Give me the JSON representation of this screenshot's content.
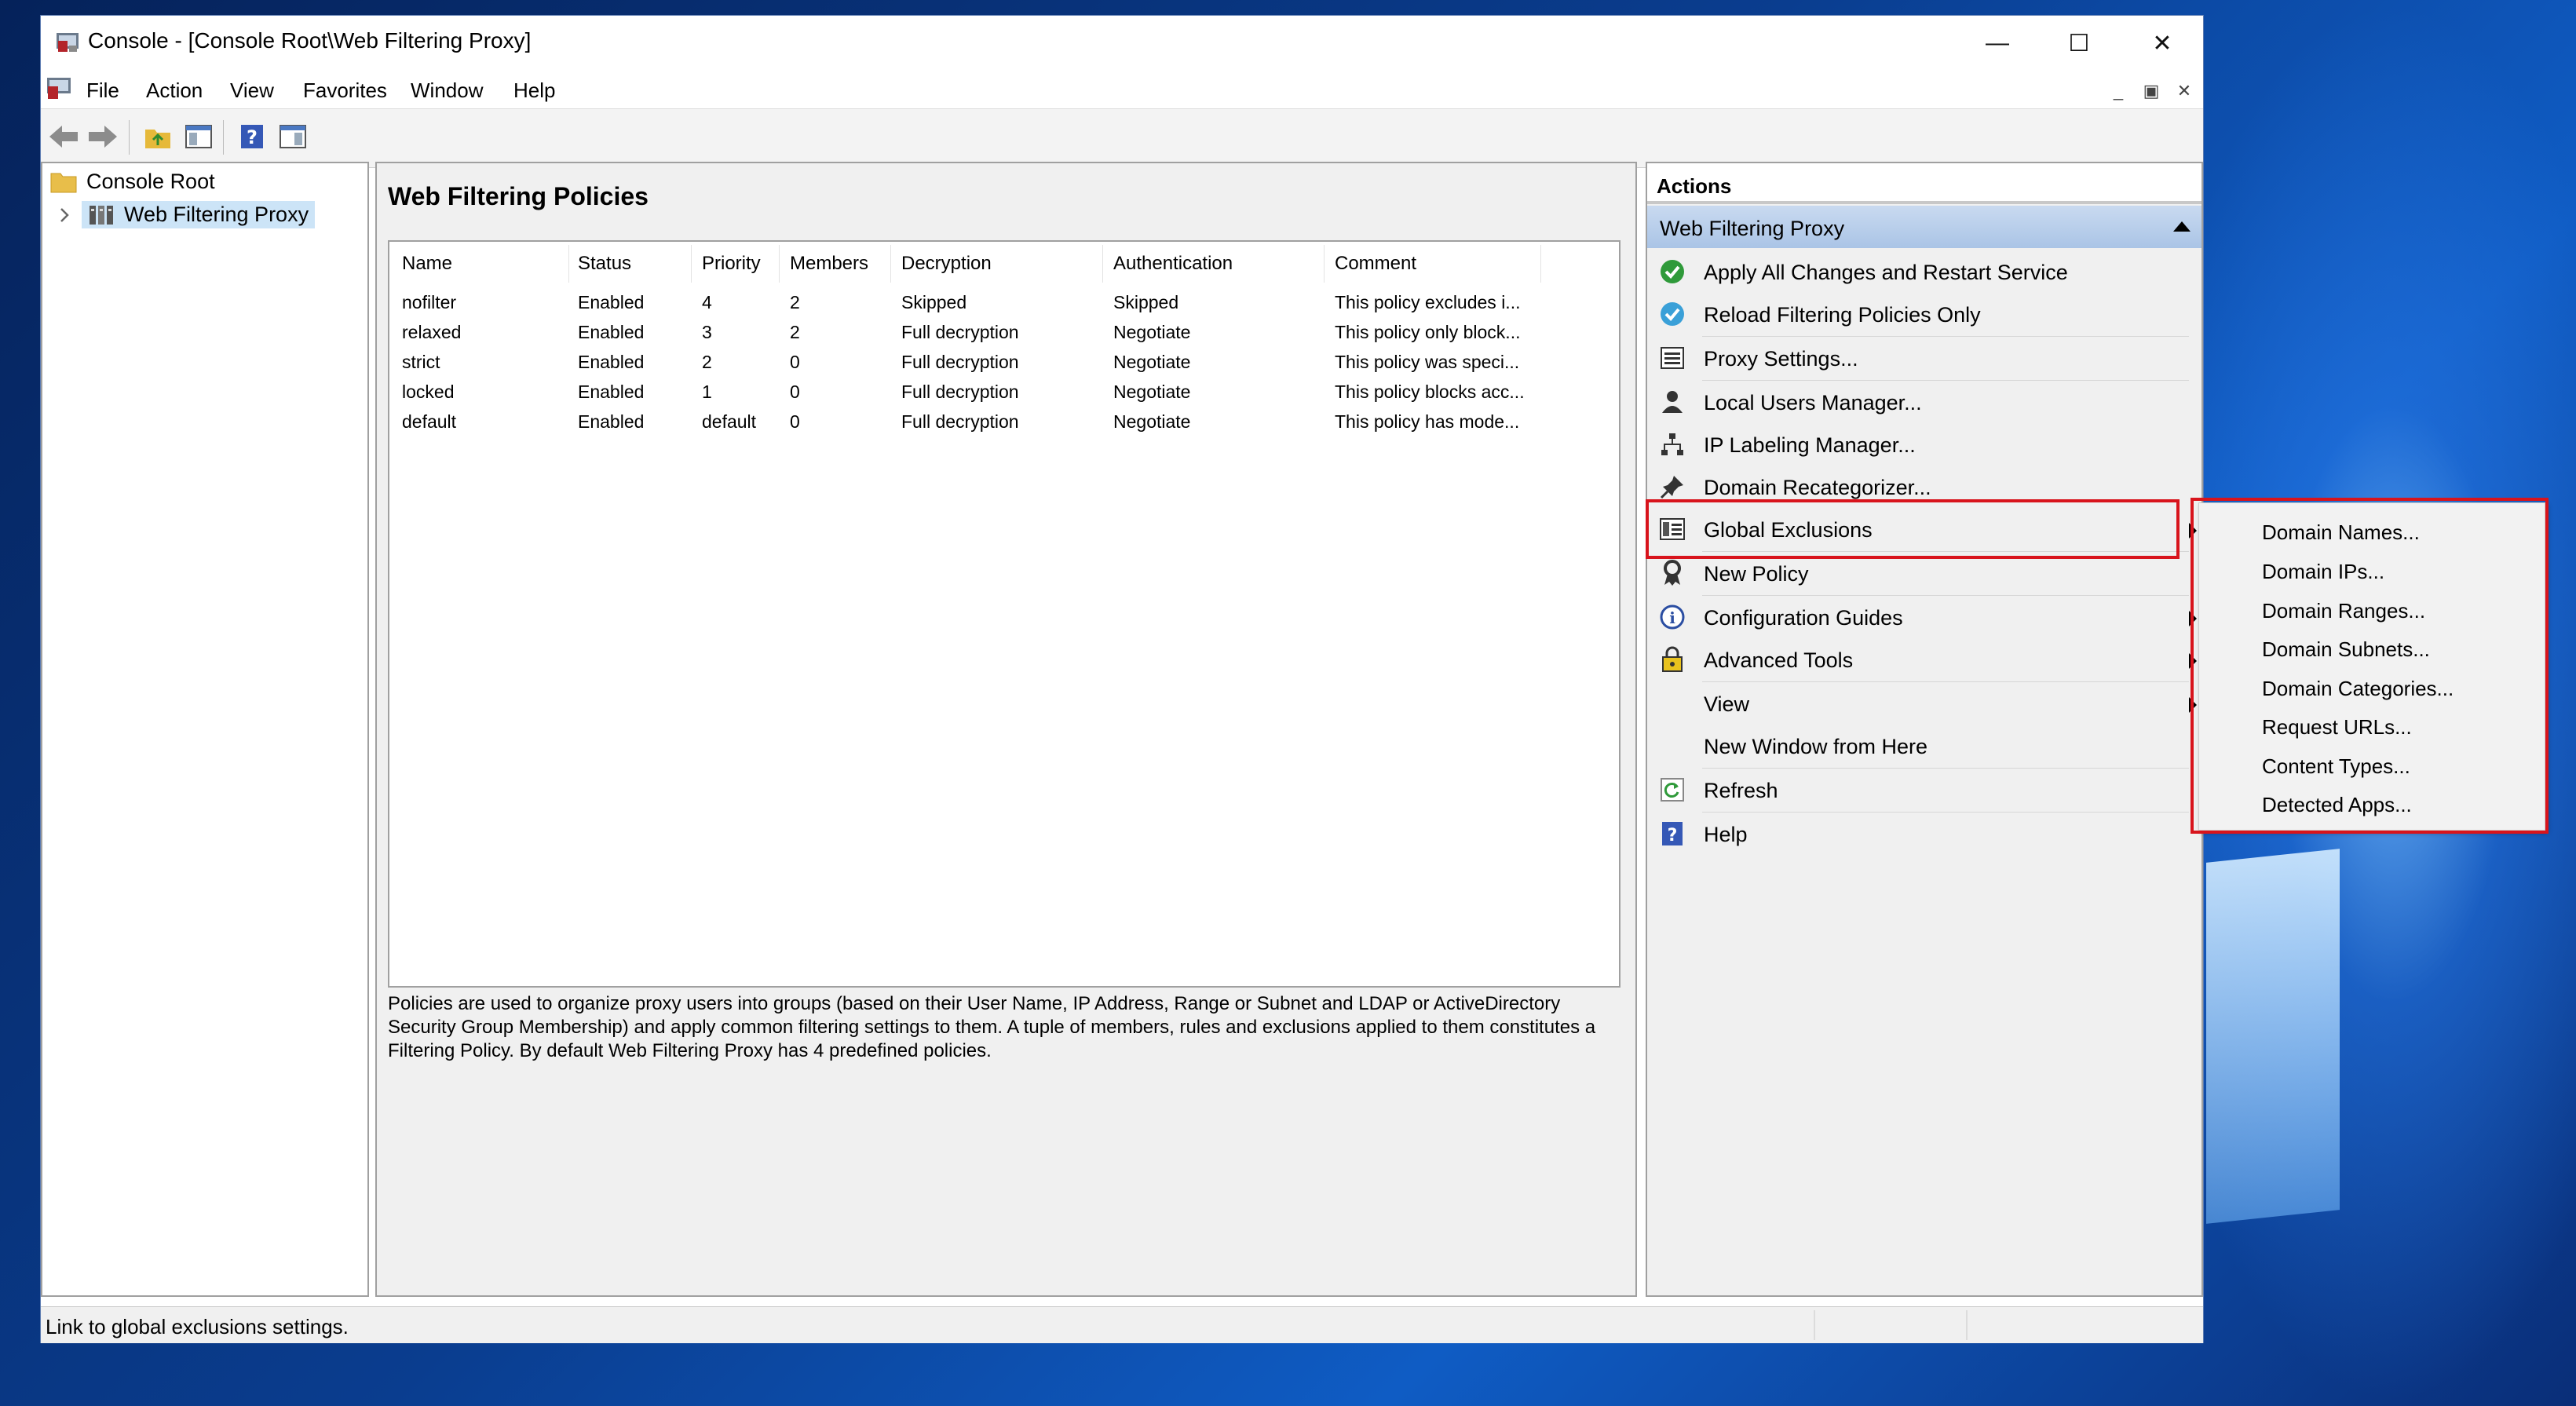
{
  "window": {
    "title": "Console - [Console Root\\Web Filtering Proxy]",
    "minimize_symbol": "—",
    "maximize_symbol": "☐",
    "close_symbol": "✕",
    "mdi_minimize_symbol": "_",
    "mdi_restore_symbol": "▣",
    "mdi_close_symbol": "✕"
  },
  "menu": [
    "File",
    "Action",
    "View",
    "Favorites",
    "Window",
    "Help"
  ],
  "tree": {
    "root": "Console Root",
    "child": "Web Filtering Proxy"
  },
  "center": {
    "title": "Web Filtering Policies",
    "columns": [
      "Name",
      "Status",
      "Priority",
      "Members",
      "Decryption",
      "Authentication",
      "Comment"
    ],
    "rows": [
      [
        "nofilter",
        "Enabled",
        "4",
        "2",
        "Skipped",
        "Skipped",
        "This policy excludes i..."
      ],
      [
        "relaxed",
        "Enabled",
        "3",
        "2",
        "Full decryption",
        "Negotiate",
        "This policy only block..."
      ],
      [
        "strict",
        "Enabled",
        "2",
        "0",
        "Full decryption",
        "Negotiate",
        "This policy was speci..."
      ],
      [
        "locked",
        "Enabled",
        "1",
        "0",
        "Full decryption",
        "Negotiate",
        "This policy blocks acc..."
      ],
      [
        "default",
        "Enabled",
        "default",
        "0",
        "Full decryption",
        "Negotiate",
        "This policy has mode..."
      ]
    ],
    "description_lines": [
      "Policies are used to organize proxy users into groups (based on their User Name, IP Address, Range or Subnet and LDAP or ActiveDirectory",
      "Security Group Membership) and apply common filtering settings to them. A tuple of members, rules and exclusions applied to them constitutes a",
      "Filtering Policy. By default Web Filtering Proxy has 4 predefined policies."
    ]
  },
  "actions": {
    "header": "Actions",
    "group": "Web Filtering Proxy",
    "items": [
      {
        "label": "Apply All Changes and Restart Service",
        "icon": "check-circle-icon"
      },
      {
        "label": "Reload Filtering Policies Only",
        "icon": "check-circle-blue-icon"
      },
      {
        "label": "Proxy Settings...",
        "icon": "settings-list-icon"
      },
      {
        "label": "Local Users Manager...",
        "icon": "user-icon"
      },
      {
        "label": "IP Labeling Manager...",
        "icon": "network-icon"
      },
      {
        "label": "Domain Recategorizer...",
        "icon": "pin-icon"
      },
      {
        "label": "Global Exclusions",
        "icon": "exclusions-icon"
      },
      {
        "label": "New Policy",
        "icon": "ribbon-icon"
      },
      {
        "label": "Configuration Guides",
        "icon": "info-icon"
      },
      {
        "label": "Advanced Tools",
        "icon": "lock-icon"
      },
      {
        "label": "View",
        "icon": ""
      },
      {
        "label": "New Window from Here",
        "icon": ""
      },
      {
        "label": "Refresh",
        "icon": "refresh-icon"
      },
      {
        "label": "Help",
        "icon": "help-icon"
      }
    ]
  },
  "submenu": [
    "Domain Names...",
    "Domain IPs...",
    "Domain Ranges...",
    "Domain Subnets...",
    "Domain Categories...",
    "Request URLs...",
    "Content Types...",
    "Detected Apps..."
  ],
  "status": "Link to global exclusions settings.",
  "colors": {
    "highlight_box": "#d8141c",
    "actions_group_bg": "#b8cfec",
    "tree_selection": "#cce4f7"
  }
}
